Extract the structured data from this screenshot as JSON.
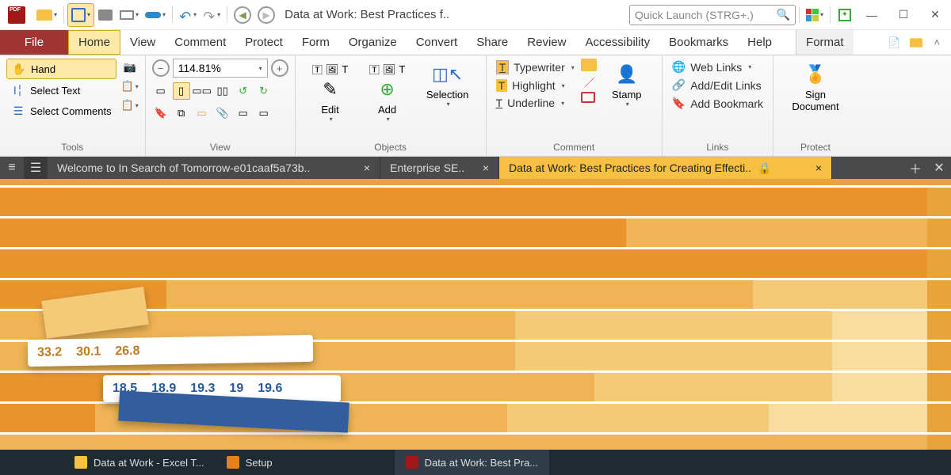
{
  "titlebar": {
    "doc_title": "Data at Work: Best Practices f..",
    "search_placeholder": "Quick Launch (STRG+.)"
  },
  "menu": {
    "file": "File",
    "items": [
      "Home",
      "View",
      "Comment",
      "Protect",
      "Form",
      "Organize",
      "Convert",
      "Share",
      "Review",
      "Accessibility",
      "Bookmarks",
      "Help"
    ],
    "format": "Format"
  },
  "ribbon": {
    "tools": {
      "hand": "Hand",
      "select_text": "Select Text",
      "select_comments": "Select Comments",
      "label": "Tools"
    },
    "view": {
      "zoom": "114.81%",
      "label": "View"
    },
    "objects": {
      "edit": "Edit",
      "add": "Add",
      "selection": "Selection",
      "label": "Objects"
    },
    "comment": {
      "typewriter": "Typewriter",
      "highlight": "Highlight",
      "underline": "Underline",
      "stamp": "Stamp",
      "label": "Comment"
    },
    "links": {
      "web": "Web Links",
      "addedit": "Add/Edit Links",
      "bookmark": "Add Bookmark",
      "label": "Links"
    },
    "protect": {
      "sign": "Sign\nDocument",
      "label": "Protect"
    }
  },
  "tabs": {
    "t1": "Welcome to In Search of Tomorrow-e01caaf5a73b..",
    "t2": "Enterprise SE..",
    "t3": "Data at Work: Best Practices for Creating Effecti.."
  },
  "chart_data": {
    "type": "bar",
    "title": "",
    "row_top_values": [
      33.2,
      30.1,
      26.8
    ],
    "row_bottom_values": [
      18.5,
      18.9,
      19.3,
      19,
      19.6
    ]
  },
  "taskbar": {
    "t1": "Data at Work - Excel T...",
    "t2": "Setup",
    "t3": "Data at Work: Best Pra..."
  }
}
